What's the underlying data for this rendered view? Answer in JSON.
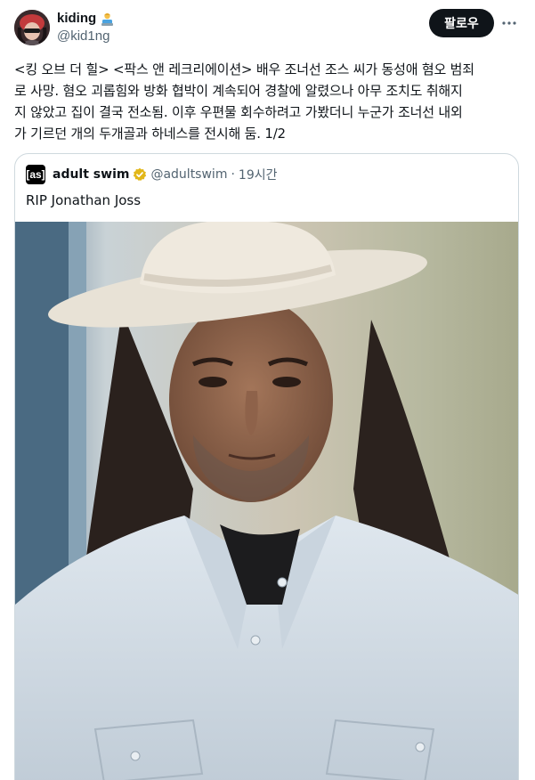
{
  "author": {
    "display_name": "kiding",
    "handle": "@kid1ng",
    "avatar_icon": "profile-avatar",
    "badge_icon": "person-emoji-icon"
  },
  "actions": {
    "follow_label": "팔로우",
    "more_icon": "more-dots-icon"
  },
  "tweet": {
    "text": "<킹 오브 더 힐> <팍스 앤 레크리에이션> 배우 조너선 조스 씨가 동성애 혐오 범죄\n로 사망. 혐오 괴롭힘와 방화 협박이 계속되어 경찰에 알렸으나 아무 조치도 취해지\n지 않았고 집이 결국 전소됨. 이후 우편물 회수하려고 가봤더니 누군가 조너선 내외\n가 기르던 개의 두개골과 하네스를 전시해 둠. 1/2"
  },
  "quoted": {
    "avatar_text": "[as]",
    "display_name": "adult swim",
    "verified_icon": "verified-gold-badge-icon",
    "handle": "@adultswim",
    "separator": "·",
    "time": "19시간",
    "text": "RIP Jonathan Joss",
    "media_description_icon": "portrait-photo"
  },
  "colors": {
    "text": "#0f1419",
    "secondary": "#536471",
    "border": "#cfd9de",
    "button_bg": "#0f1419",
    "verified_gold": "#e2b719"
  }
}
